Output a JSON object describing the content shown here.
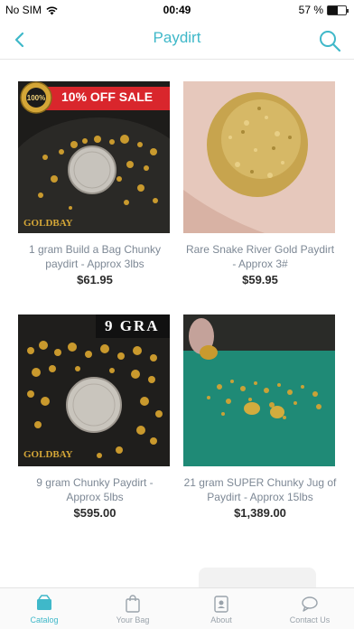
{
  "status": {
    "carrier": "No SIM",
    "time": "00:49",
    "battery": "57 %",
    "battery_level": 0.57
  },
  "nav": {
    "title": "Paydirt"
  },
  "products": [
    {
      "name": "1 gram Build a Bag Chunky paydirt - Approx 3lbs",
      "price": "$61.95",
      "badge": "10% OFF SALE",
      "brand_logo": "GOLDBAY",
      "seal_text": "100% SATISFACTION GUARANTEE"
    },
    {
      "name": "Rare Snake River Gold Paydirt - Approx 3#",
      "price": "$59.95"
    },
    {
      "name": "9 gram Chunky Paydirt - Approx 5lbs",
      "price": "$595.00",
      "badge": "9 GRA",
      "brand_logo": "GOLDBAY"
    },
    {
      "name": "21 gram SUPER Chunky Jug of Paydirt - Approx 15lbs",
      "price": "$1,389.00"
    }
  ],
  "tabs": [
    {
      "label": "Catalog",
      "icon": "catalog-icon",
      "active": true
    },
    {
      "label": "Your Bag",
      "icon": "bag-icon",
      "active": false
    },
    {
      "label": "About",
      "icon": "about-icon",
      "active": false
    },
    {
      "label": "Contact Us",
      "icon": "chat-icon",
      "active": false
    }
  ],
  "colors": {
    "accent": "#3fb8c9",
    "price": "#2b2b2b",
    "product_name": "#7d8895"
  }
}
